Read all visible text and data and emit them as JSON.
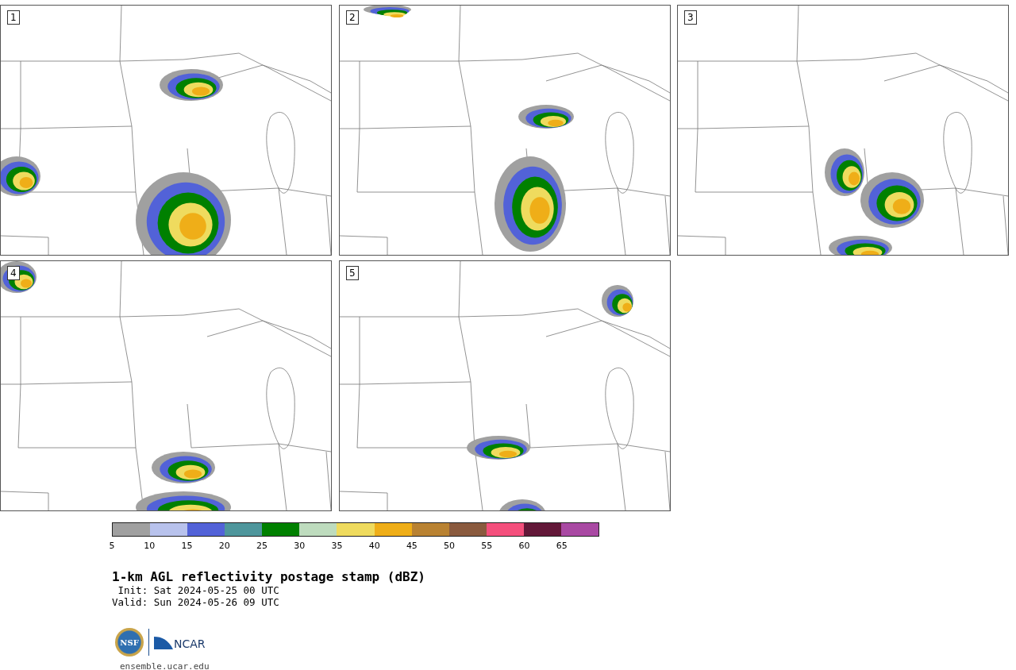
{
  "panels": [
    {
      "label": "1"
    },
    {
      "label": "2"
    },
    {
      "label": "3"
    },
    {
      "label": "4"
    },
    {
      "label": "5"
    }
  ],
  "colorbar": [
    {
      "color": "#a0a0a0",
      "tick": "5"
    },
    {
      "color": "#b8c2ec",
      "tick": "10"
    },
    {
      "color": "#5262d8",
      "tick": "15"
    },
    {
      "color": "#4e969c",
      "tick": "20"
    },
    {
      "color": "#008000",
      "tick": "25"
    },
    {
      "color": "#bedcbe",
      "tick": "30"
    },
    {
      "color": "#efdb5e",
      "tick": "35"
    },
    {
      "color": "#efae18",
      "tick": "40"
    },
    {
      "color": "#b98232",
      "tick": "45"
    },
    {
      "color": "#8a5a3e",
      "tick": "50"
    },
    {
      "color": "#f44f7c",
      "tick": "55"
    },
    {
      "color": "#621838",
      "tick": "60"
    },
    {
      "color": "#a949a3",
      "tick": "65"
    }
  ],
  "title": "1-km AGL reflectivity postage stamp (dBZ)",
  "init": " Init: Sat 2024-05-25 00 UTC",
  "valid": "Valid: Sun 2024-05-26 09 UTC",
  "logo": {
    "left": "NSF",
    "right": "NCAR"
  },
  "footer_link": "ensemble.ucar.edu"
}
